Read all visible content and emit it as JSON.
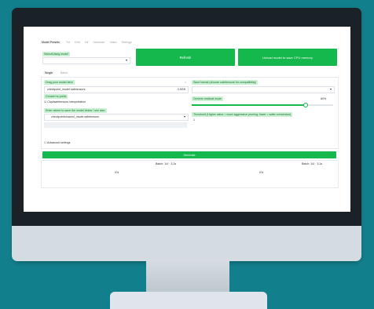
{
  "app": {
    "tabs": [
      "Model Presets",
      "Txt",
      "Grid",
      "Gif",
      "Generate",
      "Video",
      "Settings"
    ],
    "active_tab": "Model Presets"
  },
  "presets": {
    "select_label": "Select/Using model",
    "dropdown_value": "",
    "refresh_label": "Refresh",
    "unload_label": "Unload model to save CPU memory"
  },
  "subtabs": [
    "Single",
    "Batch"
  ],
  "left_panel": {
    "field1_label": "Drag your model here",
    "field1_value": "checkpoint_model.safetensors",
    "field1_badge": "3.5GB",
    "checkbox1_label": "Convert to prefix",
    "checkbox1_sub": "Ckpt/safetensors interpretation",
    "field2_label": "Enter where to save the model below / see also",
    "field2_value": "checkpoints/saved_model.safetensors"
  },
  "right_panel": {
    "field1_label": "Save format (choose safetensors for compatibility)",
    "dropdown_value": "",
    "slider_label": "Generic residual mode",
    "slider_value": "80%",
    "slider_level": 0.8,
    "note": "Threshold (Higher value = more aggressive pruning; lower = safer conversion)",
    "note_value": "1"
  },
  "options": {
    "checkbox_label": "Advanced settings"
  },
  "generate": {
    "label": "Generate"
  },
  "bottom": {
    "left_meta": "Batch: 1/4 · 3.2s",
    "left_value": "0%",
    "right_meta": "Batch: 1/4 · 3.1s",
    "right_value": "0%"
  },
  "colors": {
    "accent": "#14b84c",
    "label_bg": "#c8f0d2",
    "backdrop": "#127f8c"
  }
}
